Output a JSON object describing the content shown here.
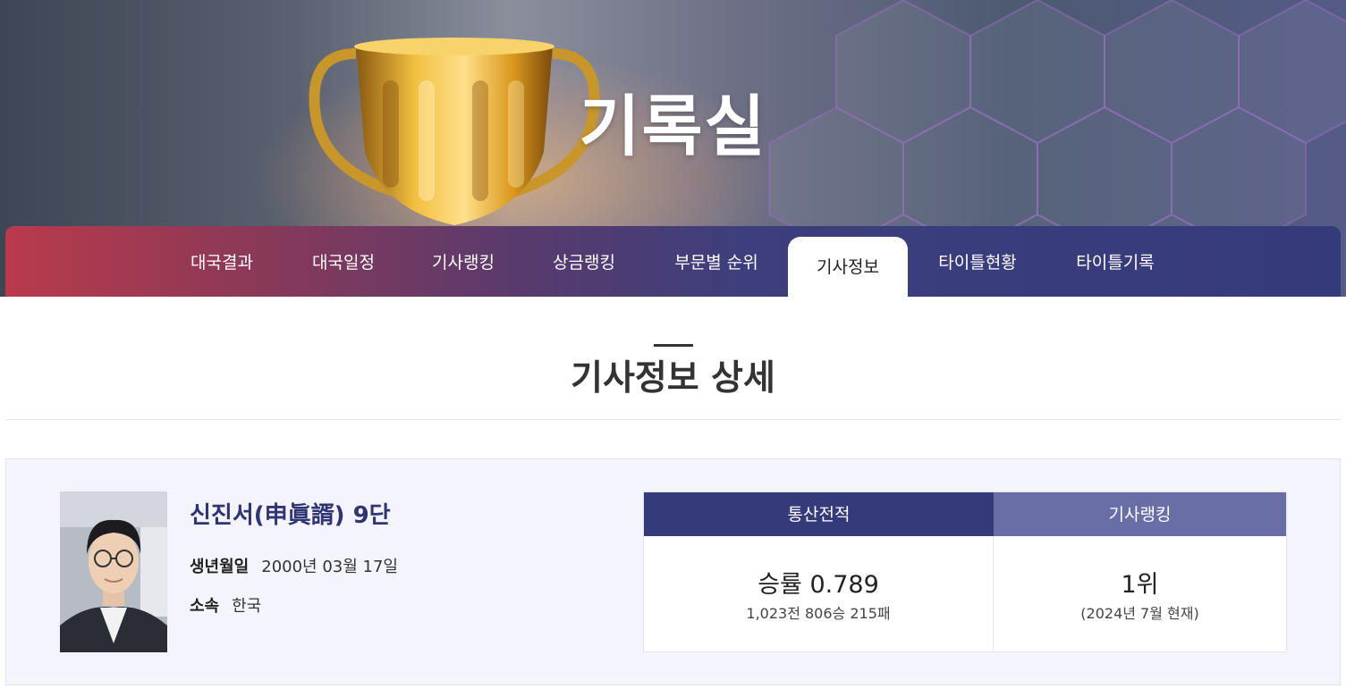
{
  "hero": {
    "title": "기록실"
  },
  "nav": {
    "tabs": [
      {
        "label": "대국결과",
        "active": false
      },
      {
        "label": "대국일정",
        "active": false
      },
      {
        "label": "기사랭킹",
        "active": false
      },
      {
        "label": "상금랭킹",
        "active": false
      },
      {
        "label": "부문별 순위",
        "active": false
      },
      {
        "label": "기사정보",
        "active": true
      },
      {
        "label": "타이틀현황",
        "active": false
      },
      {
        "label": "타이틀기록",
        "active": false
      }
    ]
  },
  "section": {
    "title": "기사정보 상세"
  },
  "player": {
    "name": "신진서(申眞諝) 9단",
    "birth_label": "생년월일",
    "birth_value": "2000년 03월 17일",
    "affil_label": "소속",
    "affil_value": "한국"
  },
  "stats": {
    "record_header": "통산전적",
    "record_main": "승률 0.789",
    "record_sub": "1,023전 806승 215패",
    "ranking_header": "기사랭킹",
    "ranking_main": "1위",
    "ranking_sub": "(2024년 7월 현재)"
  },
  "colors": {
    "nav_gradient_start": "#b93a4c",
    "nav_gradient_end": "#353a7b",
    "record_header_bg": "#343a7a",
    "ranking_header_bg": "#6a6ea7",
    "player_name": "#2f3474"
  }
}
